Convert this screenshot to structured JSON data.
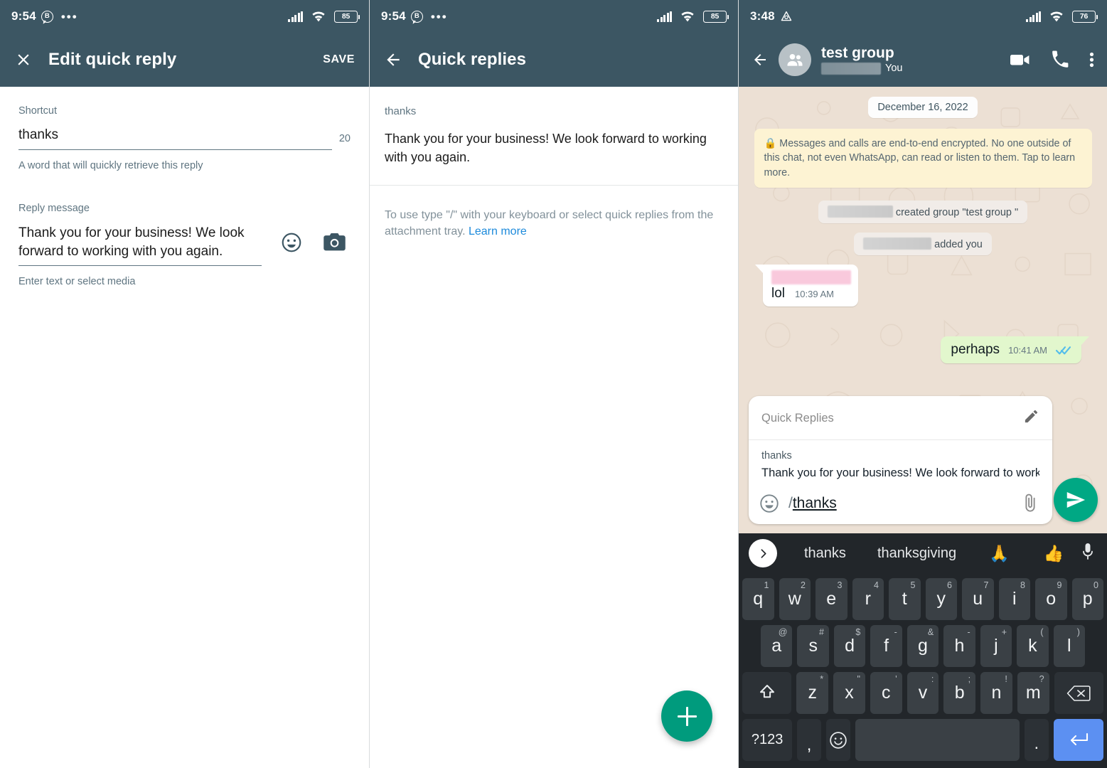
{
  "panel1": {
    "status": {
      "time": "9:54",
      "badge": "B",
      "dots": "•••",
      "battery": "85"
    },
    "appbar": {
      "close_icon": "close-icon",
      "title": "Edit quick reply",
      "save_label": "SAVE"
    },
    "shortcut": {
      "label": "Shortcut",
      "value": "thanks",
      "counter": "20",
      "help": "A word that will quickly retrieve this reply"
    },
    "reply": {
      "label": "Reply message",
      "value": "Thank you for your business! We look forward to working with you again.",
      "help": "Enter text or select media",
      "emoji_icon": "emoji-icon",
      "camera_icon": "camera-icon"
    }
  },
  "panel2": {
    "status": {
      "time": "9:54",
      "badge": "B",
      "dots": "•••",
      "battery": "85"
    },
    "appbar": {
      "back_icon": "back-arrow-icon",
      "title": "Quick replies"
    },
    "items": [
      {
        "shortcut": "thanks",
        "body": "Thank you for your business! We look forward to working with you again."
      }
    ],
    "footer": {
      "text": "To use type \"/\" with your keyboard or select quick replies from the attachment tray.",
      "link": "Learn more"
    },
    "fab": {
      "name": "add-quick-reply-fab"
    }
  },
  "panel3": {
    "status": {
      "time": "3:48",
      "battery": "76"
    },
    "appbar": {
      "back_icon": "back-arrow-icon",
      "avatar": "group-avatar",
      "title": "test group",
      "subtitle_redacted": "",
      "subtitle_you": "You",
      "video_icon": "video-call-icon",
      "call_icon": "phone-call-icon",
      "menu_icon": "overflow-menu-icon"
    },
    "chat": {
      "date_chip": "December 16, 2022",
      "encryption_notice": "Messages and calls are end-to-end encrypted. No one outside of this chat, not even WhatsApp, can read or listen to them. Tap to learn more.",
      "system_messages": [
        "created group \"test group \"",
        "added you"
      ],
      "messages": [
        {
          "direction": "in",
          "text": "lol",
          "time": "10:39 AM",
          "sender_redacted": true
        },
        {
          "direction": "out",
          "text": "perhaps",
          "time": "10:41 AM",
          "status": "read"
        }
      ]
    },
    "quick_reply_card": {
      "title": "Quick Replies",
      "edit_icon": "pencil-edit-icon",
      "shortcut": "thanks",
      "body": "Thank you for your business! We look forward to working …"
    },
    "composer": {
      "emoji_icon": "emoji-icon",
      "slash": "/",
      "value": "thanks",
      "attach_icon": "paperclip-attach-icon",
      "send_icon": "send-icon"
    },
    "keyboard": {
      "suggestions": [
        "thanks",
        "thanksgiving"
      ],
      "suggestion_emojis": [
        "🙏",
        "👍"
      ],
      "expand_icon": "chevron-right-icon",
      "mic_icon": "microphone-icon",
      "row1": [
        {
          "k": "q",
          "s": "1"
        },
        {
          "k": "w",
          "s": "2"
        },
        {
          "k": "e",
          "s": "3"
        },
        {
          "k": "r",
          "s": "4"
        },
        {
          "k": "t",
          "s": "5"
        },
        {
          "k": "y",
          "s": "6"
        },
        {
          "k": "u",
          "s": "7"
        },
        {
          "k": "i",
          "s": "8"
        },
        {
          "k": "o",
          "s": "9"
        },
        {
          "k": "p",
          "s": "0"
        }
      ],
      "row2": [
        {
          "k": "a",
          "s": "@"
        },
        {
          "k": "s",
          "s": "#"
        },
        {
          "k": "d",
          "s": "$"
        },
        {
          "k": "f",
          "s": "-"
        },
        {
          "k": "g",
          "s": "&"
        },
        {
          "k": "h",
          "s": "-"
        },
        {
          "k": "j",
          "s": "+"
        },
        {
          "k": "k",
          "s": "("
        },
        {
          "k": "l",
          "s": ")"
        }
      ],
      "row3": [
        {
          "k": "z",
          "s": "*"
        },
        {
          "k": "x",
          "s": "\""
        },
        {
          "k": "c",
          "s": "'"
        },
        {
          "k": "v",
          "s": ":"
        },
        {
          "k": "b",
          "s": ";"
        },
        {
          "k": "n",
          "s": "!"
        },
        {
          "k": "m",
          "s": "?"
        }
      ],
      "shift_icon": "shift-key-icon",
      "backspace_icon": "backspace-key-icon",
      "symbols_label": "?123",
      "comma_label": ",",
      "emoji_key_icon": "emoji-key-icon",
      "space_label": "",
      "period_label": ".",
      "enter_icon": "enter-key-icon"
    }
  },
  "colors": {
    "appbar": "#3c5663",
    "accent_green": "#009b7d",
    "send_green": "#00a884",
    "link_blue": "#1c8adb",
    "chat_bg": "#ece0d4",
    "bubble_out": "#e2f7cd",
    "e2e_bg": "#fdf3d3",
    "key_bg": "#3a4045",
    "enter_blue": "#5c90f2"
  }
}
